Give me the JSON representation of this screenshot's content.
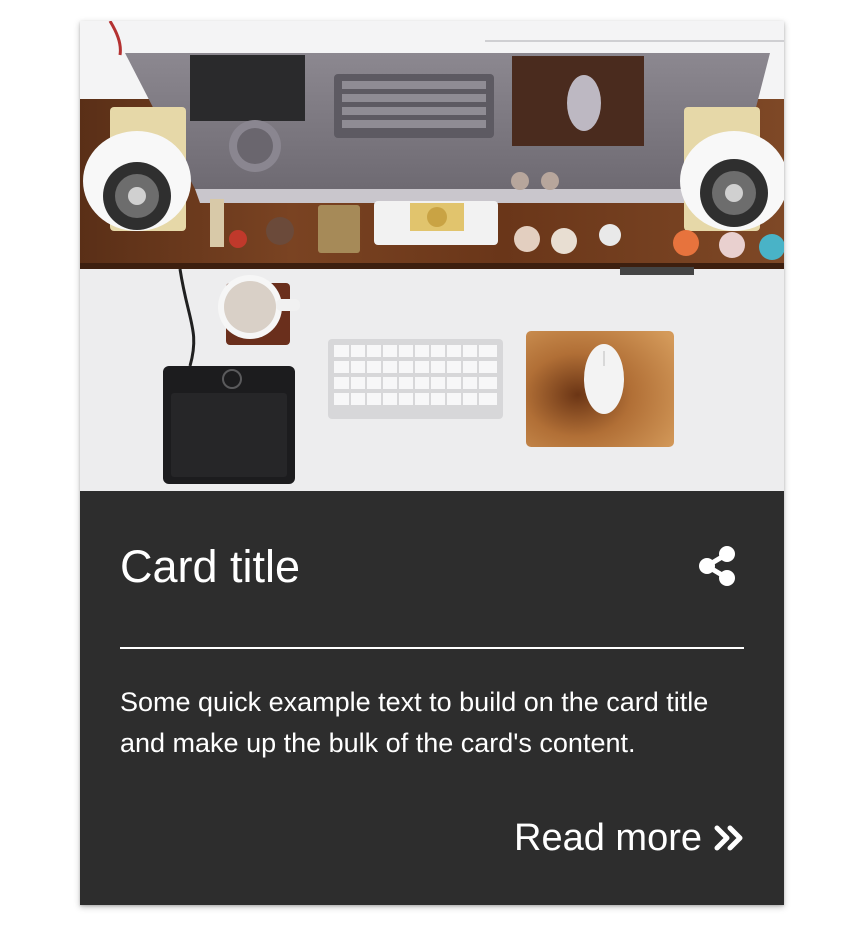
{
  "card": {
    "image_alt": "Top-down photo of a wooden desk with a computer monitor, speakers, keyboards, a mouse, a mug and a drawing tablet",
    "title": "Card title",
    "text": "Some quick example text to build on the card title and make up the bulk of the card's content.",
    "read_more_label": "Read more",
    "share_icon": "share-alt-icon",
    "read_more_icon": "angle-double-right-icon"
  },
  "colors": {
    "card_background": "#2d2d2d",
    "text": "#ffffff",
    "page_background": "#ffffff"
  }
}
